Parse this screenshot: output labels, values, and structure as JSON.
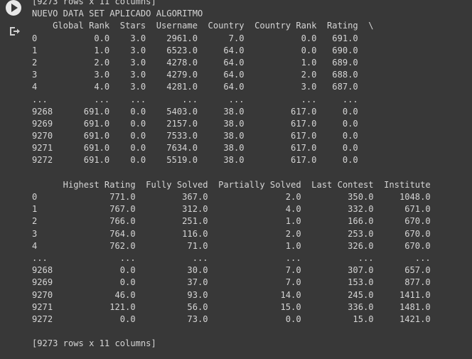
{
  "gutter": {
    "run_icon": "play-circle-icon",
    "output_icon": "output-redirect-icon"
  },
  "output": {
    "lines": [
      "[9273 rows x 11 columns]",
      "NUEVO DATA SET APLICADO ALGORITMO",
      "    Global Rank  Stars  Username  Country  Country Rank  Rating  \\",
      "0           0.0    3.0    2961.0      7.0           0.0   691.0",
      "1           1.0    3.0    6523.0     64.0           0.0   690.0",
      "2           2.0    3.0    4278.0     64.0           1.0   689.0",
      "3           3.0    3.0    4279.0     64.0           2.0   688.0",
      "4           4.0    3.0    4281.0     64.0           3.0   687.0",
      "...         ...    ...       ...      ...           ...     ...",
      "9268      691.0    0.0    5403.0     38.0         617.0     0.0",
      "9269      691.0    0.0    2157.0     38.0         617.0     0.0",
      "9270      691.0    0.0    7533.0     38.0         617.0     0.0",
      "9271      691.0    0.0    7634.0     38.0         617.0     0.0",
      "9272      691.0    0.0    5519.0     38.0         617.0     0.0",
      "",
      "      Highest Rating  Fully Solved  Partially Solved  Last Contest  Institute",
      "0              771.0         367.0               2.0         350.0     1048.0",
      "1              767.0         312.0               4.0         332.0      671.0",
      "2              766.0         251.0               1.0         166.0      670.0",
      "3              764.0         116.0               2.0         253.0      670.0",
      "4              762.0          71.0               1.0         326.0      670.0",
      "...              ...           ...               ...           ...        ...",
      "9268             0.0          30.0               7.0         307.0      657.0",
      "9269             0.0          37.0               7.0         153.0      877.0",
      "9270            46.0          93.0              14.0         245.0     1411.0",
      "9271           121.0          56.0              15.0         336.0     1481.0",
      "9272             0.0          73.0               0.0          15.0     1421.0",
      "",
      "[9273 rows x 11 columns]"
    ]
  }
}
